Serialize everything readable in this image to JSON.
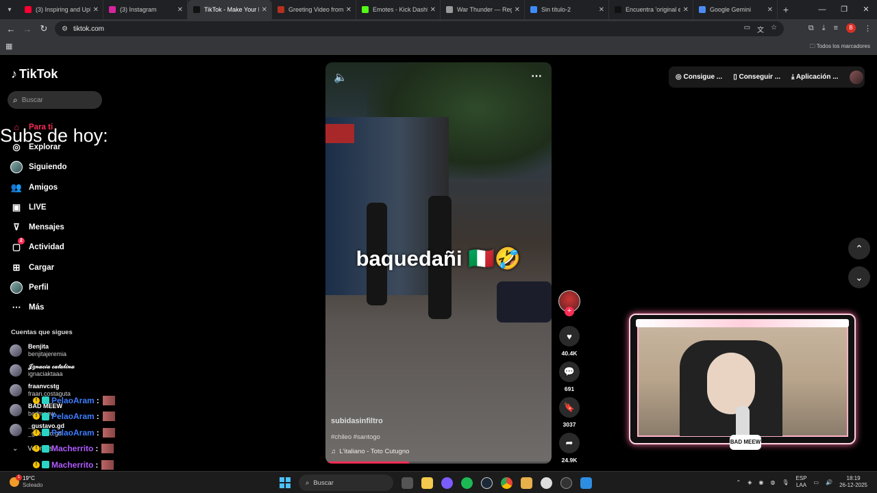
{
  "browser": {
    "tabs": [
      {
        "label": "(3) Inspiring and Uplif",
        "color": "#ff0033"
      },
      {
        "label": "(3) Instagram",
        "color": "#d6249f"
      },
      {
        "label": "TikTok - Make Your D",
        "color": "#111111"
      },
      {
        "label": "Greeting Video from",
        "color": "#b5301e"
      },
      {
        "label": "Emotes - Kick Dashbo",
        "color": "#53fc18"
      },
      {
        "label": "War Thunder — Regis",
        "color": "#9a9a9a"
      },
      {
        "label": "Sin título-2",
        "color": "#3d8bff"
      },
      {
        "label": "Encuentra 'original e",
        "color": "#111111"
      },
      {
        "label": "Google Gemini",
        "color": "#4c8bf5"
      }
    ],
    "url": "tiktok.com",
    "bookmarks_all": "Todos los marcadores",
    "profile_initial": "B"
  },
  "tiktok": {
    "logo": "TikTok",
    "search_placeholder": "Buscar",
    "nav": [
      {
        "label": "Para ti",
        "icon": "home-icon"
      },
      {
        "label": "Explorar",
        "icon": "compass-icon"
      },
      {
        "label": "Siguiendo",
        "icon": "following-avatar"
      },
      {
        "label": "Amigos",
        "icon": "friends-icon"
      },
      {
        "label": "LIVE",
        "icon": "live-icon"
      },
      {
        "label": "Mensajes",
        "icon": "messages-icon"
      },
      {
        "label": "Actividad",
        "icon": "activity-icon",
        "badge": "2"
      },
      {
        "label": "Cargar",
        "icon": "upload-icon"
      },
      {
        "label": "Perfil",
        "icon": "profile-avatar"
      },
      {
        "label": "Más",
        "icon": "more-icon"
      }
    ],
    "following_heading": "Cuentas que sigues",
    "following": [
      {
        "name": "Benjita",
        "user": "benjitajeremia"
      },
      {
        "name": "𝒥𝑔𝓃𝒶𝒸𝒾𝒶 𝒸𝒶𝓉𝒶𝓁𝒾𝓃𝒶",
        "user": "ignaciaktaaa"
      },
      {
        "name": "fraanvcstg",
        "user": "fraan.costaguta"
      },
      {
        "name": "BAD MEEW",
        "user": "badmeew"
      },
      {
        "name": "_gustavo.gd",
        "user": "_gustavo.gd"
      }
    ],
    "see_more": "Ver más",
    "topbar": {
      "coins": "Consigue ...",
      "get": "Conseguir ...",
      "app": "Aplicación ..."
    }
  },
  "video": {
    "caption": "baquedañi 🇮🇹🤣",
    "user": "subidasinfiltro",
    "tags": "#chileo #santogo",
    "music": "L'italiano - Toto Cutugno",
    "likes": "40.4K",
    "comments": "691",
    "saves": "3037",
    "shares": "24.9K",
    "progress": 0.37
  },
  "stream": {
    "overlay_title": "Subs de hoy:",
    "chat": [
      {
        "user": "PelaoAram",
        "color": "#3d7dff",
        "sep": ":"
      },
      {
        "user": "PelaoAram",
        "color": "#3d7dff",
        "sep": ":"
      },
      {
        "user": "PelaoAram",
        "color": "#3d7dff",
        "sep": ":"
      },
      {
        "user": "Macherrito",
        "color": "#b05cff",
        "sep": ":"
      },
      {
        "user": "Macherrito",
        "color": "#b05cff",
        "sep": ":"
      }
    ],
    "cam_logo": "BAD MEEW"
  },
  "taskbar": {
    "temp": "19°C",
    "weather": "Soleado",
    "weather_badge": "1",
    "search": "Buscar",
    "lang1": "ESP",
    "lang2": "LAA",
    "time": "18:19",
    "date": "26-12-2025"
  }
}
